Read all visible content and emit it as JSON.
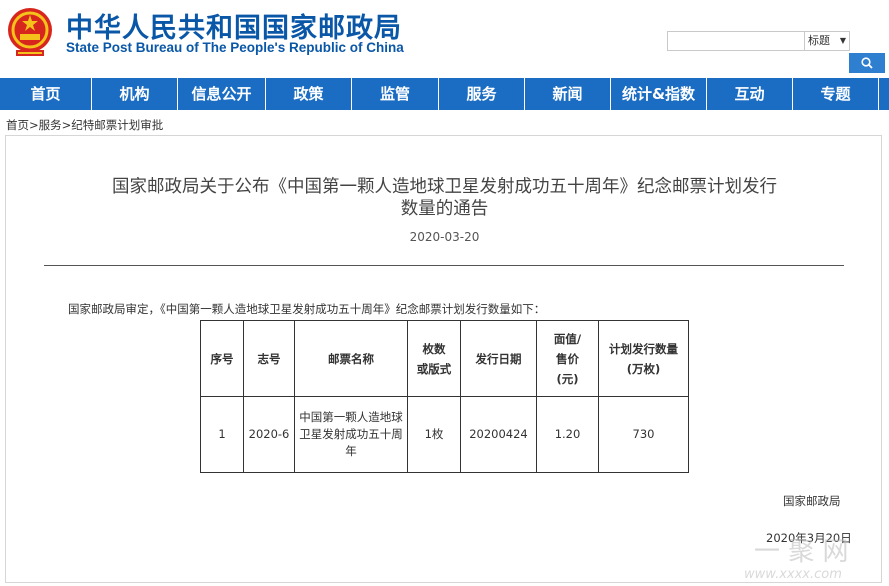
{
  "header": {
    "title": "中华人民共和国国家邮政局",
    "subtitle": "State Post Bureau of The People's Republic of China",
    "emblem_icon": "national-emblem-icon"
  },
  "search": {
    "value": "",
    "placeholder": "",
    "select_value": "标题",
    "button_icon": "search-icon"
  },
  "nav": {
    "items": [
      {
        "label": "首页"
      },
      {
        "label": "机构"
      },
      {
        "label": "信息公开"
      },
      {
        "label": "政策"
      },
      {
        "label": "监管"
      },
      {
        "label": "服务"
      },
      {
        "label": "新闻"
      },
      {
        "label": "统计&指数"
      },
      {
        "label": "互动"
      },
      {
        "label": "专题"
      }
    ]
  },
  "breadcrumb": {
    "home": "首页",
    "sep1": ">",
    "service": "服务",
    "sep2": ">",
    "current": "纪特邮票计划审批"
  },
  "article": {
    "title_line1": "国家邮政局关于公布《中国第一颗人造地球卫星发射成功五十周年》纪念邮票计划发行",
    "title_line2": "数量的通告",
    "date": "2020-03-20",
    "intro": "国家邮政局审定，《中国第一颗人造地球卫星发射成功五十周年》纪念邮票计划发行数量如下：",
    "signature": "国家邮政局",
    "sign_date": "2020年3月20日"
  },
  "table": {
    "headers": [
      "序号",
      "志号",
      "邮票名称",
      "枚数或版式",
      "发行日期",
      "面值/售价(元)",
      "计划发行数量(万枚)"
    ],
    "header_lines": [
      [
        "序号"
      ],
      [
        "志号"
      ],
      [
        "邮票名称"
      ],
      [
        "枚数",
        "或版式"
      ],
      [
        "发行日期"
      ],
      [
        "面值/",
        "售价",
        "(元)"
      ],
      [
        "计划发行数量",
        "(万枚)"
      ]
    ],
    "rows": [
      {
        "no": "1",
        "code": "2020-6",
        "name": "中国第一颗人造地球卫星发射成功五十周年",
        "name_lines": [
          "中国第一颗人造地球",
          "卫星发射成功五十周",
          "年"
        ],
        "count": "1枚",
        "date": "20200424",
        "price": "1.20",
        "quantity": "730"
      }
    ]
  },
  "colors": {
    "brand_blue": "#0a57a8",
    "nav_blue": "#1a6dc3",
    "search_button": "#2e7fd0"
  }
}
